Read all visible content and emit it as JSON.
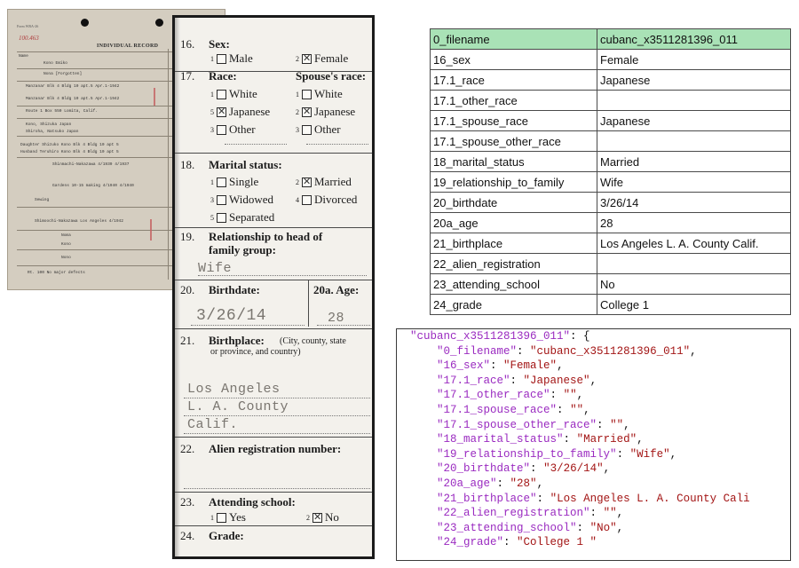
{
  "scan": {
    "corner_label": "Form WRA-26",
    "red_mark": "100.463",
    "title": "INDIVIDUAL RECORD",
    "lines": [
      "Name",
      "Kono          Emiko",
      "Nona [Forgotten]",
      "Manzanar Blk 4 Bldg 10 apt.5    Apr.1-1942",
      "Manzanar Blk 4 Bldg 10 apt.5    Apr.1-1942",
      "Route 1 Box 550   Lomita, Calif.",
      "Kono, Shizuka            Japan",
      "Shiroha, Natsuko         Japan",
      "Daughter Shizuko Kono Blk 4 Bldg 10 apt 5",
      "Husband Teruhiro Kono Blk 4 Bldg 10 apt 5",
      "Shinmachi-Nakazawa      4/1939  4/1937",
      "Gardens 10-15 making   4/1940  4/1940",
      "Sewing",
      "Shimoochi-Nakazawa Los Angeles 4/1942",
      "Noma",
      "Kono",
      "Nono",
      "Rt. 100  No major defects"
    ]
  },
  "crop": {
    "q16": {
      "num": "16.",
      "label": "Sex:",
      "opt1": "Male",
      "opt2": "Female"
    },
    "q17": {
      "num": "17.",
      "label": "Race:",
      "spouse_label": "Spouse's race:",
      "opt_white": "White",
      "opt_japanese": "Japanese",
      "opt_other": "Other",
      "sup1": "1",
      "sup2": "2",
      "sup3": "3",
      "sup4": "4",
      "sup5": "5"
    },
    "q18": {
      "num": "18.",
      "label": "Marital status:",
      "single": "Single",
      "married": "Married",
      "widowed": "Widowed",
      "divorced": "Divorced",
      "separated": "Separated"
    },
    "q19": {
      "num": "19.",
      "label_line1": "Relationship to head of",
      "label_line2": "family group:",
      "value": "Wife"
    },
    "q20": {
      "num": "20.",
      "label": "Birthdate:",
      "value": "3/26/14",
      "age_label": "20a. Age:",
      "age_value": "28"
    },
    "q21": {
      "num": "21.",
      "label": "Birthplace:",
      "hint1": "(City, county, state",
      "hint2": "or province, and country)",
      "value1": "Los Angeles",
      "value2": "L. A. County",
      "value3": "Calif."
    },
    "q22": {
      "num": "22.",
      "label": "Alien registration number:"
    },
    "q23": {
      "num": "23.",
      "label": "Attending school:",
      "yes": "Yes",
      "no": "No"
    },
    "q24": {
      "num": "24.",
      "label": "Grade:"
    }
  },
  "table": {
    "rows": [
      {
        "key": "0_filename",
        "value": "cubanc_x3511281396_011"
      },
      {
        "key": "16_sex",
        "value": "Female"
      },
      {
        "key": "17.1_race",
        "value": "Japanese"
      },
      {
        "key": "17.1_other_race",
        "value": ""
      },
      {
        "key": "17.1_spouse_race",
        "value": "Japanese"
      },
      {
        "key": "17.1_spouse_other_race",
        "value": ""
      },
      {
        "key": "18_marital_status",
        "value": "Married"
      },
      {
        "key": "19_relationship_to_family",
        "value": "Wife"
      },
      {
        "key": "20_birthdate",
        "value": "3/26/14"
      },
      {
        "key": "20a_age",
        "value": "28"
      },
      {
        "key": "21_birthplace",
        "value": "Los Angeles L. A. County Calif."
      },
      {
        "key": "22_alien_registration",
        "value": ""
      },
      {
        "key": "23_attending_school",
        "value": "No"
      },
      {
        "key": "24_grade",
        "value": "College 1"
      }
    ]
  },
  "code": {
    "root_key": "\"cubanc_x3511281396_011\"",
    "entries": [
      {
        "key": "\"0_filename\"",
        "value": "\"cubanc_x3511281396_011\""
      },
      {
        "key": "\"16_sex\"",
        "value": "\"Female\""
      },
      {
        "key": "\"17.1_race\"",
        "value": "\"Japanese\""
      },
      {
        "key": "\"17.1_other_race\"",
        "value": "\"\""
      },
      {
        "key": "\"17.1_spouse_race\"",
        "value": "\"\""
      },
      {
        "key": "\"17.1_spouse_other_race\"",
        "value": "\"\""
      },
      {
        "key": "\"18_marital_status\"",
        "value": "\"Married\""
      },
      {
        "key": "\"19_relationship_to_family\"",
        "value": "\"Wife\""
      },
      {
        "key": "\"20_birthdate\"",
        "value": "\"3/26/14\""
      },
      {
        "key": "\"20a_age\"",
        "value": "\"28\""
      },
      {
        "key": "\"21_birthplace\"",
        "value": "\"Los Angeles L. A. County Cali"
      },
      {
        "key": "\"22_alien_registration\"",
        "value": "\"\""
      },
      {
        "key": "\"23_attending_school\"",
        "value": "\"No\""
      },
      {
        "key": "\"24_grade\"",
        "value": "\"College 1 \""
      }
    ]
  },
  "colors": {
    "header_row": "#a9e2b6",
    "json_key": "#9a2ac0",
    "json_value": "#a31515"
  }
}
